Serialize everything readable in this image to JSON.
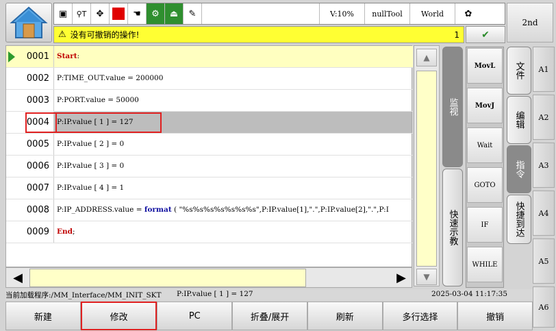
{
  "toolbar": {
    "icons": [
      "monitor-icon",
      "robot-arm-icon",
      "joint-icon",
      "stop-icon",
      "hand-icon",
      "run-icon",
      "return-icon",
      "document-icon"
    ],
    "velocity": "V:10%",
    "tool": "nullTool",
    "frame": "World",
    "second_label": "2nd"
  },
  "message": {
    "text": "没有可撤销的操作!",
    "count": "1"
  },
  "editor": {
    "lines": [
      {
        "num": "0001",
        "parts": [
          {
            "t": "Start",
            "c": "kw"
          },
          {
            "t": ":",
            "c": ""
          }
        ]
      },
      {
        "num": "0002",
        "parts": [
          {
            "t": "P:TIME_OUT.value = 200000",
            "c": ""
          }
        ]
      },
      {
        "num": "0003",
        "parts": [
          {
            "t": "P:PORT.value = 50000",
            "c": ""
          }
        ]
      },
      {
        "num": "0004",
        "parts": [
          {
            "t": "P:IP.value [ 1 ] = 127",
            "c": ""
          }
        ]
      },
      {
        "num": "0005",
        "parts": [
          {
            "t": "P:IP.value [ 2 ] = 0",
            "c": ""
          }
        ]
      },
      {
        "num": "0006",
        "parts": [
          {
            "t": "P:IP.value [ 3 ] = 0",
            "c": ""
          }
        ]
      },
      {
        "num": "0007",
        "parts": [
          {
            "t": "P:IP.value [ 4 ] = 1",
            "c": ""
          }
        ]
      },
      {
        "num": "0008",
        "parts": [
          {
            "t": "P:IP_ADDRESS.value = ",
            "c": ""
          },
          {
            "t": "format",
            "c": "fn"
          },
          {
            "t": " ( \"%s%s%s%s%s%s%s\",P:IP.value[1],\".\",P:IP.value[2],\".\",P:I",
            "c": ""
          }
        ]
      },
      {
        "num": "0009",
        "parts": [
          {
            "t": "End",
            "c": "kw"
          },
          {
            "t": ";",
            "c": ""
          }
        ]
      }
    ]
  },
  "tabs": {
    "monitor": "监视",
    "quick_teach": "快速示教",
    "file": "文件",
    "edit": "编辑",
    "command": "指令",
    "quick_reach": "快捷到达"
  },
  "commands": [
    "MovL",
    "MovJ",
    "Wait",
    "GOTO",
    "IF",
    "WHILE"
  ],
  "side_buttons": [
    "A1",
    "A2",
    "A3",
    "A4",
    "A5",
    "A6"
  ],
  "status": {
    "program": "当前加载程序:/MM_Interface/MM_INIT_SKT",
    "selected_line": "P:IP.value [ 1 ] = 127",
    "datetime": "2025-03-04 11:17:35"
  },
  "bottom": [
    "新建",
    "修改",
    "PC",
    "折叠/展开",
    "刷新",
    "多行选择",
    "撤销"
  ]
}
